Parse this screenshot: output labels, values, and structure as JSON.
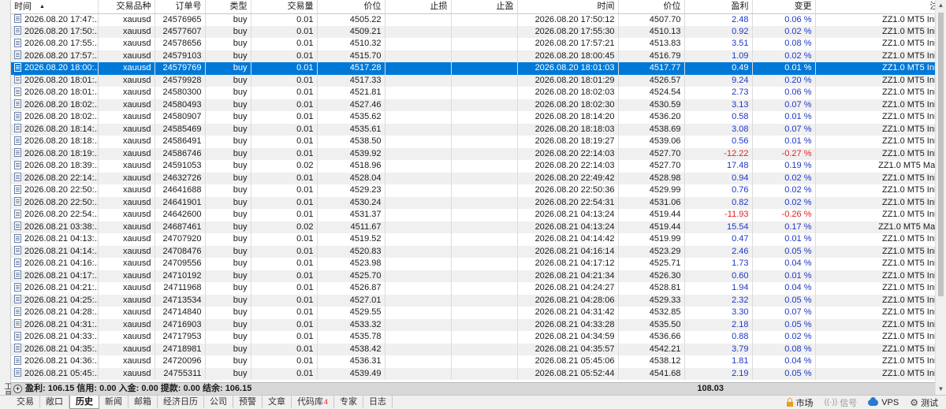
{
  "side_panel": {
    "label": "工具箱"
  },
  "columns": {
    "open_time": "时间",
    "symbol": "交易品种",
    "ticket": "订单号",
    "type": "类型",
    "volume": "交易量",
    "open_price": "价位",
    "sl": "止损",
    "tp": "止盈",
    "close_time": "时间",
    "close_price": "价位",
    "profit": "盈利",
    "change": "变更",
    "comment": "注释"
  },
  "rows": [
    {
      "open_time": "2026.08.20 17:47:...",
      "symbol": "xauusd",
      "ticket": "24576965",
      "type": "buy",
      "volume": "0.01",
      "open_price": "4505.22",
      "sl": "",
      "tp": "",
      "close_time": "2026.08.20 17:50:12",
      "close_price": "4507.70",
      "profit": "2.48",
      "change": "0.06 %",
      "comment": "ZZ1.0 MT5 Initial"
    },
    {
      "open_time": "2026.08.20 17:50:...",
      "symbol": "xauusd",
      "ticket": "24577607",
      "type": "buy",
      "volume": "0.01",
      "open_price": "4509.21",
      "sl": "",
      "tp": "",
      "close_time": "2026.08.20 17:55:30",
      "close_price": "4510.13",
      "profit": "0.92",
      "change": "0.02 %",
      "comment": "ZZ1.0 MT5 Initial"
    },
    {
      "open_time": "2026.08.20 17:55:...",
      "symbol": "xauusd",
      "ticket": "24578656",
      "type": "buy",
      "volume": "0.01",
      "open_price": "4510.32",
      "sl": "",
      "tp": "",
      "close_time": "2026.08.20 17:57:21",
      "close_price": "4513.83",
      "profit": "3.51",
      "change": "0.08 %",
      "comment": "ZZ1.0 MT5 Initial"
    },
    {
      "open_time": "2026.08.20 17:57:...",
      "symbol": "xauusd",
      "ticket": "24579103",
      "type": "buy",
      "volume": "0.01",
      "open_price": "4515.70",
      "sl": "",
      "tp": "",
      "close_time": "2026.08.20 18:00:45",
      "close_price": "4516.79",
      "profit": "1.09",
      "change": "0.02 %",
      "comment": "ZZ1.0 MT5 Initial"
    },
    {
      "open_time": "2026.08.20 18:00:...",
      "symbol": "xauusd",
      "ticket": "24579769",
      "type": "buy",
      "volume": "0.01",
      "open_price": "4517.28",
      "sl": "",
      "tp": "",
      "close_time": "2026.08.20 18:01:03",
      "close_price": "4517.77",
      "profit": "0.49",
      "change": "0.01 %",
      "comment": "ZZ1.0 MT5 Initial",
      "selected": true
    },
    {
      "open_time": "2026.08.20 18:01:...",
      "symbol": "xauusd",
      "ticket": "24579928",
      "type": "buy",
      "volume": "0.01",
      "open_price": "4517.33",
      "sl": "",
      "tp": "",
      "close_time": "2026.08.20 18:01:29",
      "close_price": "4526.57",
      "profit": "9.24",
      "change": "0.20 %",
      "comment": "ZZ1.0 MT5 Initial"
    },
    {
      "open_time": "2026.08.20 18:01:...",
      "symbol": "xauusd",
      "ticket": "24580300",
      "type": "buy",
      "volume": "0.01",
      "open_price": "4521.81",
      "sl": "",
      "tp": "",
      "close_time": "2026.08.20 18:02:03",
      "close_price": "4524.54",
      "profit": "2.73",
      "change": "0.06 %",
      "comment": "ZZ1.0 MT5 Initial"
    },
    {
      "open_time": "2026.08.20 18:02:...",
      "symbol": "xauusd",
      "ticket": "24580493",
      "type": "buy",
      "volume": "0.01",
      "open_price": "4527.46",
      "sl": "",
      "tp": "",
      "close_time": "2026.08.20 18:02:30",
      "close_price": "4530.59",
      "profit": "3.13",
      "change": "0.07 %",
      "comment": "ZZ1.0 MT5 Initial"
    },
    {
      "open_time": "2026.08.20 18:02:...",
      "symbol": "xauusd",
      "ticket": "24580907",
      "type": "buy",
      "volume": "0.01",
      "open_price": "4535.62",
      "sl": "",
      "tp": "",
      "close_time": "2026.08.20 18:14:20",
      "close_price": "4536.20",
      "profit": "0.58",
      "change": "0.01 %",
      "comment": "ZZ1.0 MT5 Initial"
    },
    {
      "open_time": "2026.08.20 18:14:...",
      "symbol": "xauusd",
      "ticket": "24585469",
      "type": "buy",
      "volume": "0.01",
      "open_price": "4535.61",
      "sl": "",
      "tp": "",
      "close_time": "2026.08.20 18:18:03",
      "close_price": "4538.69",
      "profit": "3.08",
      "change": "0.07 %",
      "comment": "ZZ1.0 MT5 Initial"
    },
    {
      "open_time": "2026.08.20 18:18:...",
      "symbol": "xauusd",
      "ticket": "24586491",
      "type": "buy",
      "volume": "0.01",
      "open_price": "4538.50",
      "sl": "",
      "tp": "",
      "close_time": "2026.08.20 18:19:27",
      "close_price": "4539.06",
      "profit": "0.56",
      "change": "0.01 %",
      "comment": "ZZ1.0 MT5 Initial"
    },
    {
      "open_time": "2026.08.20 18:19:...",
      "symbol": "xauusd",
      "ticket": "24586746",
      "type": "buy",
      "volume": "0.01",
      "open_price": "4539.92",
      "sl": "",
      "tp": "",
      "close_time": "2026.08.20 22:14:03",
      "close_price": "4527.70",
      "profit": "-12.22",
      "change": "-0.27 %",
      "comment": "ZZ1.0 MT5 Initial"
    },
    {
      "open_time": "2026.08.20 18:39:...",
      "symbol": "xauusd",
      "ticket": "24591053",
      "type": "buy",
      "volume": "0.02",
      "open_price": "4518.96",
      "sl": "",
      "tp": "",
      "close_time": "2026.08.20 22:14:03",
      "close_price": "4527.70",
      "profit": "17.48",
      "change": "0.19 %",
      "comment": "ZZ1.0 MT5 Martin"
    },
    {
      "open_time": "2026.08.20 22:14:...",
      "symbol": "xauusd",
      "ticket": "24632726",
      "type": "buy",
      "volume": "0.01",
      "open_price": "4528.04",
      "sl": "",
      "tp": "",
      "close_time": "2026.08.20 22:49:42",
      "close_price": "4528.98",
      "profit": "0.94",
      "change": "0.02 %",
      "comment": "ZZ1.0 MT5 Initial"
    },
    {
      "open_time": "2026.08.20 22:50:...",
      "symbol": "xauusd",
      "ticket": "24641688",
      "type": "buy",
      "volume": "0.01",
      "open_price": "4529.23",
      "sl": "",
      "tp": "",
      "close_time": "2026.08.20 22:50:36",
      "close_price": "4529.99",
      "profit": "0.76",
      "change": "0.02 %",
      "comment": "ZZ1.0 MT5 Initial"
    },
    {
      "open_time": "2026.08.20 22:50:...",
      "symbol": "xauusd",
      "ticket": "24641901",
      "type": "buy",
      "volume": "0.01",
      "open_price": "4530.24",
      "sl": "",
      "tp": "",
      "close_time": "2026.08.20 22:54:31",
      "close_price": "4531.06",
      "profit": "0.82",
      "change": "0.02 %",
      "comment": "ZZ1.0 MT5 Initial"
    },
    {
      "open_time": "2026.08.20 22:54:...",
      "symbol": "xauusd",
      "ticket": "24642600",
      "type": "buy",
      "volume": "0.01",
      "open_price": "4531.37",
      "sl": "",
      "tp": "",
      "close_time": "2026.08.21 04:13:24",
      "close_price": "4519.44",
      "profit": "-11.93",
      "change": "-0.26 %",
      "comment": "ZZ1.0 MT5 Initial"
    },
    {
      "open_time": "2026.08.21 03:38:...",
      "symbol": "xauusd",
      "ticket": "24687461",
      "type": "buy",
      "volume": "0.02",
      "open_price": "4511.67",
      "sl": "",
      "tp": "",
      "close_time": "2026.08.21 04:13:24",
      "close_price": "4519.44",
      "profit": "15.54",
      "change": "0.17 %",
      "comment": "ZZ1.0 MT5 Martin"
    },
    {
      "open_time": "2026.08.21 04:13:...",
      "symbol": "xauusd",
      "ticket": "24707920",
      "type": "buy",
      "volume": "0.01",
      "open_price": "4519.52",
      "sl": "",
      "tp": "",
      "close_time": "2026.08.21 04:14:42",
      "close_price": "4519.99",
      "profit": "0.47",
      "change": "0.01 %",
      "comment": "ZZ1.0 MT5 Initial"
    },
    {
      "open_time": "2026.08.21 04:14:...",
      "symbol": "xauusd",
      "ticket": "24708476",
      "type": "buy",
      "volume": "0.01",
      "open_price": "4520.83",
      "sl": "",
      "tp": "",
      "close_time": "2026.08.21 04:16:14",
      "close_price": "4523.29",
      "profit": "2.46",
      "change": "0.05 %",
      "comment": "ZZ1.0 MT5 Initial"
    },
    {
      "open_time": "2026.08.21 04:16:...",
      "symbol": "xauusd",
      "ticket": "24709556",
      "type": "buy",
      "volume": "0.01",
      "open_price": "4523.98",
      "sl": "",
      "tp": "",
      "close_time": "2026.08.21 04:17:12",
      "close_price": "4525.71",
      "profit": "1.73",
      "change": "0.04 %",
      "comment": "ZZ1.0 MT5 Initial"
    },
    {
      "open_time": "2026.08.21 04:17:...",
      "symbol": "xauusd",
      "ticket": "24710192",
      "type": "buy",
      "volume": "0.01",
      "open_price": "4525.70",
      "sl": "",
      "tp": "",
      "close_time": "2026.08.21 04:21:34",
      "close_price": "4526.30",
      "profit": "0.60",
      "change": "0.01 %",
      "comment": "ZZ1.0 MT5 Initial"
    },
    {
      "open_time": "2026.08.21 04:21:...",
      "symbol": "xauusd",
      "ticket": "24711968",
      "type": "buy",
      "volume": "0.01",
      "open_price": "4526.87",
      "sl": "",
      "tp": "",
      "close_time": "2026.08.21 04:24:27",
      "close_price": "4528.81",
      "profit": "1.94",
      "change": "0.04 %",
      "comment": "ZZ1.0 MT5 Initial"
    },
    {
      "open_time": "2026.08.21 04:25:...",
      "symbol": "xauusd",
      "ticket": "24713534",
      "type": "buy",
      "volume": "0.01",
      "open_price": "4527.01",
      "sl": "",
      "tp": "",
      "close_time": "2026.08.21 04:28:06",
      "close_price": "4529.33",
      "profit": "2.32",
      "change": "0.05 %",
      "comment": "ZZ1.0 MT5 Initial"
    },
    {
      "open_time": "2026.08.21 04:28:...",
      "symbol": "xauusd",
      "ticket": "24714840",
      "type": "buy",
      "volume": "0.01",
      "open_price": "4529.55",
      "sl": "",
      "tp": "",
      "close_time": "2026.08.21 04:31:42",
      "close_price": "4532.85",
      "profit": "3.30",
      "change": "0.07 %",
      "comment": "ZZ1.0 MT5 Initial"
    },
    {
      "open_time": "2026.08.21 04:31:...",
      "symbol": "xauusd",
      "ticket": "24716903",
      "type": "buy",
      "volume": "0.01",
      "open_price": "4533.32",
      "sl": "",
      "tp": "",
      "close_time": "2026.08.21 04:33:28",
      "close_price": "4535.50",
      "profit": "2.18",
      "change": "0.05 %",
      "comment": "ZZ1.0 MT5 Initial"
    },
    {
      "open_time": "2026.08.21 04:33:...",
      "symbol": "xauusd",
      "ticket": "24717953",
      "type": "buy",
      "volume": "0.01",
      "open_price": "4535.78",
      "sl": "",
      "tp": "",
      "close_time": "2026.08.21 04:34:59",
      "close_price": "4536.66",
      "profit": "0.88",
      "change": "0.02 %",
      "comment": "ZZ1.0 MT5 Initial"
    },
    {
      "open_time": "2026.08.21 04:35:...",
      "symbol": "xauusd",
      "ticket": "24718981",
      "type": "buy",
      "volume": "0.01",
      "open_price": "4538.42",
      "sl": "",
      "tp": "",
      "close_time": "2026.08.21 04:35:57",
      "close_price": "4542.21",
      "profit": "3.79",
      "change": "0.08 %",
      "comment": "ZZ1.0 MT5 Initial"
    },
    {
      "open_time": "2026.08.21 04:36:...",
      "symbol": "xauusd",
      "ticket": "24720096",
      "type": "buy",
      "volume": "0.01",
      "open_price": "4536.31",
      "sl": "",
      "tp": "",
      "close_time": "2026.08.21 05:45:06",
      "close_price": "4538.12",
      "profit": "1.81",
      "change": "0.04 %",
      "comment": "ZZ1.0 MT5 Initial"
    },
    {
      "open_time": "2026.08.21 05:45:...",
      "symbol": "xauusd",
      "ticket": "24755311",
      "type": "buy",
      "volume": "0.01",
      "open_price": "4539.49",
      "sl": "",
      "tp": "",
      "close_time": "2026.08.21 05:52:44",
      "close_price": "4541.68",
      "profit": "2.19",
      "change": "0.05 %",
      "comment": "ZZ1.0 MT5 Initial"
    }
  ],
  "summary": {
    "text": "盈利: 106.15  信用: 0.00  入金: 0.00  提款: 0.00  结余: 106.15",
    "total_profit": "108.03"
  },
  "tabs": [
    {
      "label": "交易"
    },
    {
      "label": "敞口"
    },
    {
      "label": "历史",
      "active": true
    },
    {
      "label": "新闻"
    },
    {
      "label": "邮箱"
    },
    {
      "label": "经济日历"
    },
    {
      "label": "公司"
    },
    {
      "label": "预警"
    },
    {
      "label": "文章"
    },
    {
      "label": "代码库",
      "badge": "4"
    },
    {
      "label": "专家"
    },
    {
      "label": "日志"
    }
  ],
  "status": {
    "market": "市场",
    "signals": "信号",
    "vps": "VPS",
    "tester": "测试"
  },
  "colors": {
    "selection": "#0078d7",
    "profit_positive": "#1d38c6",
    "profit_negative": "#e61e1e"
  }
}
